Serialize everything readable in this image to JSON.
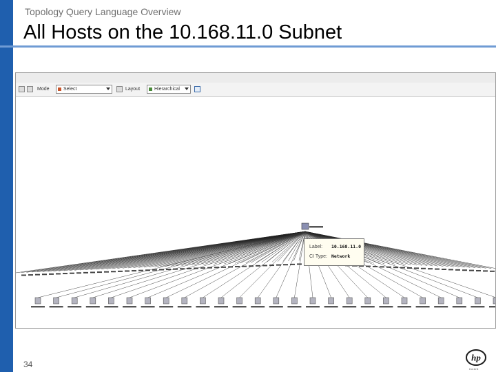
{
  "slide": {
    "header_label": "Topology Query Language Overview",
    "title": "All Hosts on the 10.168.11.0 Subnet",
    "page_number": "34"
  },
  "toolbar": {
    "mode_label": "Mode",
    "mode_value": "Select",
    "layout_label": "Layout",
    "layout_value": "Hierarchical"
  },
  "tooltip": {
    "label_key": "Label:",
    "label_value": "10.168.11.0",
    "ci_type_key": "CI Type:",
    "ci_type_value": "Network"
  },
  "logo": {
    "text": "hp",
    "tagline": "invent"
  },
  "colors": {
    "accent_bar": "#1f5fae",
    "rule": "#6f9bd4"
  },
  "icons": [
    "arrow-icon",
    "pointer-icon",
    "dropdown-icon",
    "host-icon",
    "network-icon",
    "hp-logo-icon"
  ]
}
